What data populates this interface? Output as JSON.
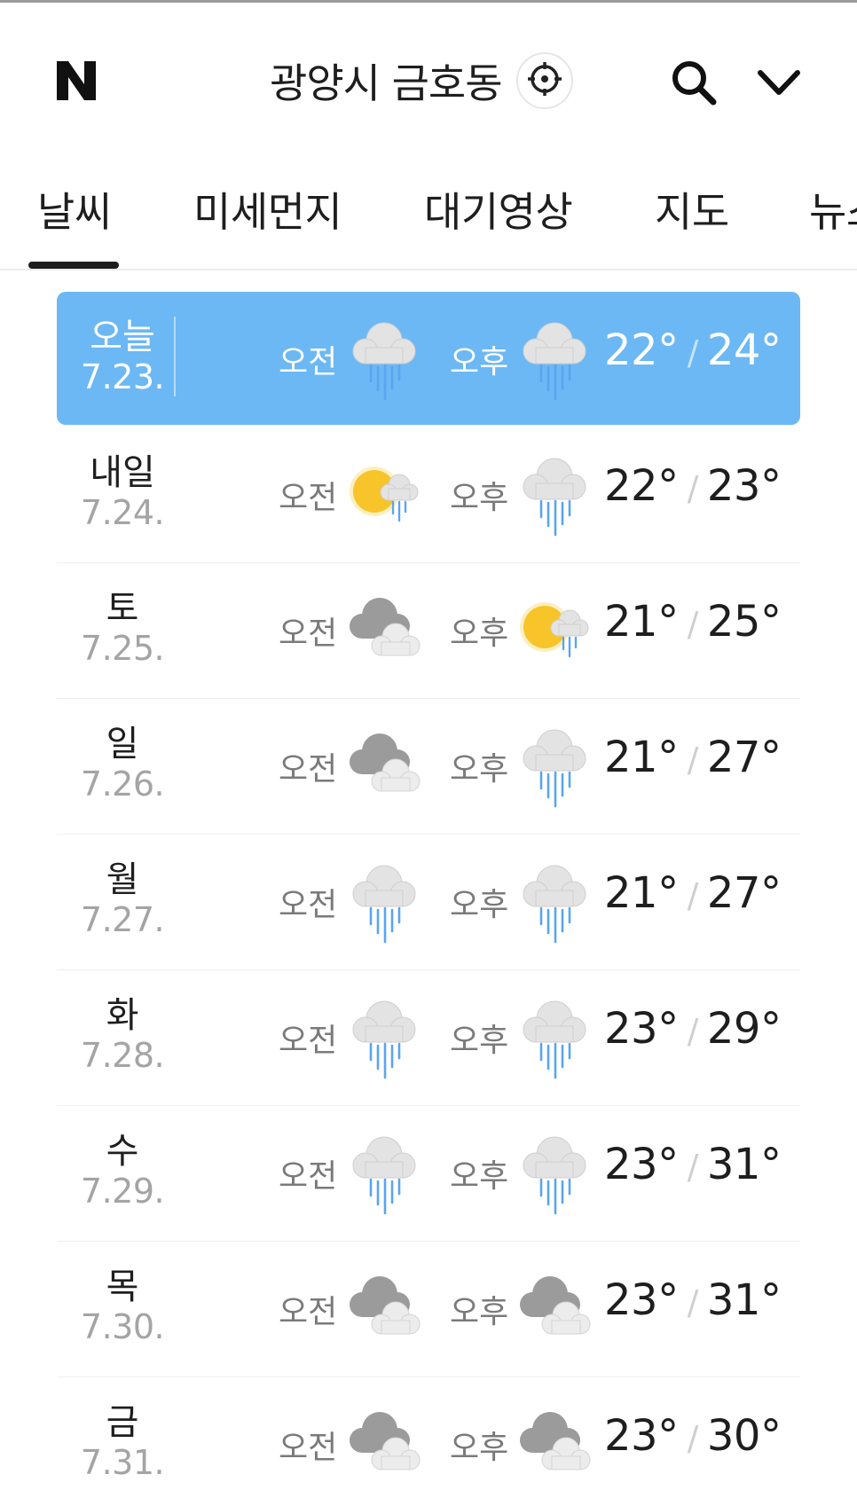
{
  "header": {
    "logo_text": "N",
    "location": "광양시 금호동",
    "icons": {
      "locate": "crosshair-icon",
      "search": "search-icon",
      "menu": "chevron-down-icon"
    }
  },
  "tabs": [
    {
      "label": "날씨",
      "active": true
    },
    {
      "label": "미세먼지"
    },
    {
      "label": "대기영상"
    },
    {
      "label": "지도"
    },
    {
      "label": "뉴스"
    }
  ],
  "colors": {
    "today_bg": "#6cb8f4",
    "sun": "#f7c42a",
    "rain": "#5aa5f0",
    "cloud_dark": "#9a9a9a",
    "cloud_light": "#e4e4e4"
  },
  "forecast": [
    {
      "day": "오늘",
      "date": "7.23.",
      "am_label": "오전",
      "am_icon": "rain-icon",
      "pm_label": "오후",
      "pm_icon": "rain-icon",
      "low": "22°",
      "sep": "/",
      "high": "24°",
      "today": true
    },
    {
      "day": "내일",
      "date": "7.24.",
      "am_label": "오전",
      "am_icon": "sun-rain-icon",
      "pm_label": "오후",
      "pm_icon": "rain-icon",
      "low": "22°",
      "sep": "/",
      "high": "23°"
    },
    {
      "day": "토",
      "date": "7.25.",
      "am_label": "오전",
      "am_icon": "cloudy-icon",
      "pm_label": "오후",
      "pm_icon": "sun-rain-icon",
      "low": "21°",
      "sep": "/",
      "high": "25°"
    },
    {
      "day": "일",
      "date": "7.26.",
      "am_label": "오전",
      "am_icon": "cloudy-icon",
      "pm_label": "오후",
      "pm_icon": "rain-icon",
      "low": "21°",
      "sep": "/",
      "high": "27°"
    },
    {
      "day": "월",
      "date": "7.27.",
      "am_label": "오전",
      "am_icon": "rain-icon",
      "pm_label": "오후",
      "pm_icon": "rain-icon",
      "low": "21°",
      "sep": "/",
      "high": "27°"
    },
    {
      "day": "화",
      "date": "7.28.",
      "am_label": "오전",
      "am_icon": "rain-icon",
      "pm_label": "오후",
      "pm_icon": "rain-icon",
      "low": "23°",
      "sep": "/",
      "high": "29°"
    },
    {
      "day": "수",
      "date": "7.29.",
      "am_label": "오전",
      "am_icon": "rain-icon",
      "pm_label": "오후",
      "pm_icon": "rain-icon",
      "low": "23°",
      "sep": "/",
      "high": "31°"
    },
    {
      "day": "목",
      "date": "7.30.",
      "am_label": "오전",
      "am_icon": "cloudy-icon",
      "pm_label": "오후",
      "pm_icon": "cloudy-icon",
      "low": "23°",
      "sep": "/",
      "high": "31°"
    },
    {
      "day": "금",
      "date": "7.31.",
      "am_label": "오전",
      "am_icon": "cloudy-icon",
      "pm_label": "오후",
      "pm_icon": "cloudy-icon",
      "low": "23°",
      "sep": "/",
      "high": "30°"
    }
  ]
}
